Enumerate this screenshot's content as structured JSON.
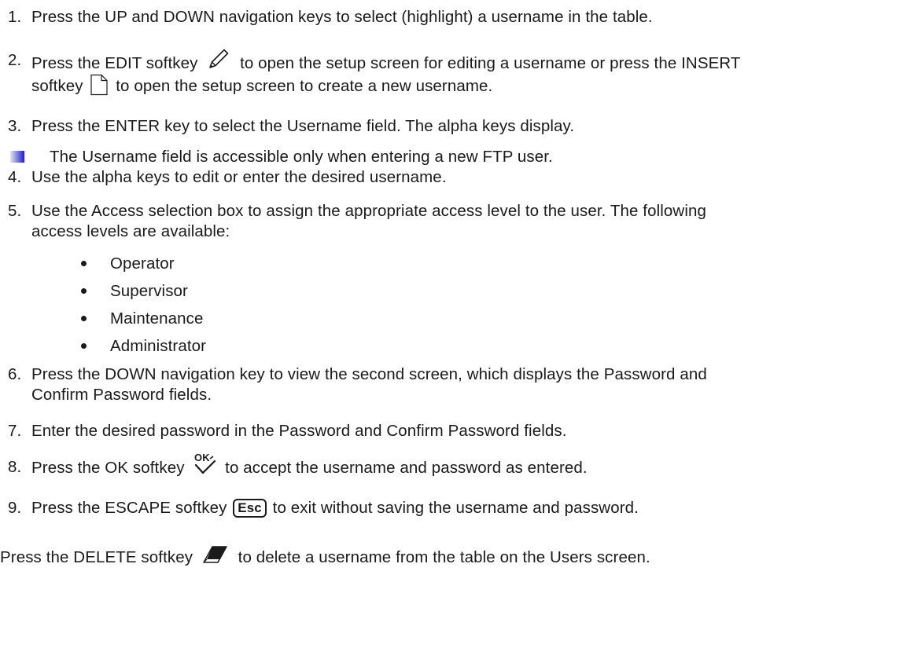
{
  "steps": [
    {
      "num": "1.",
      "lines": [
        "Press the UP and DOWN navigation keys to select (highlight) a username in the table."
      ]
    },
    {
      "num": "2.",
      "line1_before": "Press the EDIT softkey",
      "line1_after": "to open the setup screen for editing a username or press the INSERT",
      "line2_before": "softkey",
      "line2_after": "to open the setup screen to create a new username."
    },
    {
      "num": "3.",
      "lines": [
        "Press the ENTER key to select the Username field. The alpha keys display."
      ]
    },
    {
      "num": "4.",
      "lines": [
        "Use the alpha keys to edit or enter the desired username."
      ]
    },
    {
      "num": "5.",
      "lines": [
        "Use the Access selection box to assign the appropriate access level to the user. The following",
        "access levels are available:"
      ]
    },
    {
      "num": "6.",
      "lines": [
        "Press the DOWN navigation key to view the second screen, which displays the Password and",
        "Confirm Password fields."
      ]
    },
    {
      "num": "7.",
      "lines": [
        "Enter the desired password in the Password and Confirm Password fields."
      ]
    },
    {
      "num": "8.",
      "before": "Press the OK softkey",
      "after": "to accept the username and password as entered."
    },
    {
      "num": "9.",
      "before": "Press the ESCAPE softkey",
      "key": "Esc",
      "after": "to exit without saving the username and password."
    }
  ],
  "note": "The Username field is accessible only when entering a new FTP user.",
  "access_levels": [
    "Operator",
    "Supervisor",
    "Maintenance",
    "Administrator"
  ],
  "final": {
    "before": "Press the DELETE softkey",
    "after": "to delete a username from the table on the Users screen."
  },
  "icons": {
    "edit": "pencil-icon",
    "insert": "document-icon",
    "ok": "ok-check-icon",
    "escape": "esc-key-icon",
    "delete": "eraser-icon",
    "note": "note-marker-icon"
  },
  "colors": {
    "text": "#1a1a1a",
    "note_marker": "#1e1ed2"
  }
}
